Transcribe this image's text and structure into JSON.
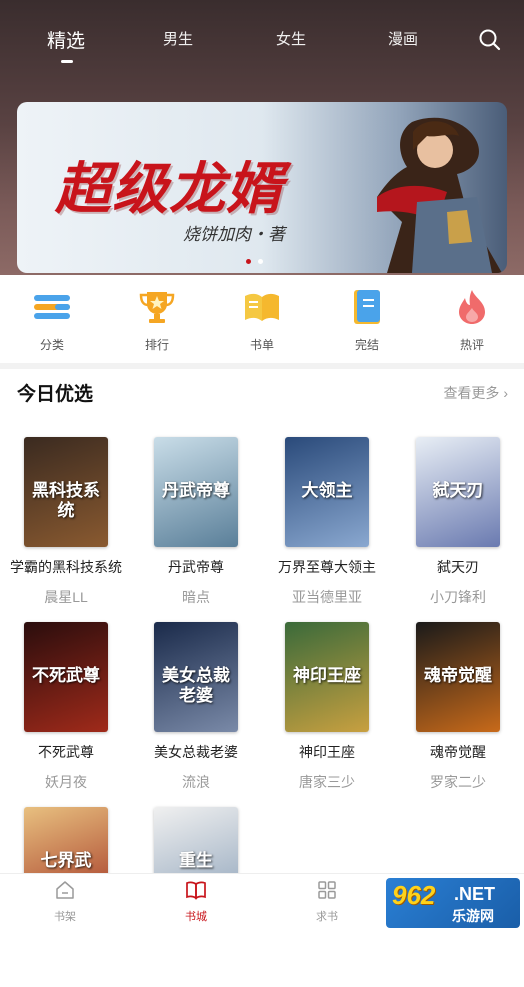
{
  "status_bar": {
    "time": "",
    "signal": ""
  },
  "top_tabs": [
    {
      "label": "精选",
      "active": true
    },
    {
      "label": "男生",
      "active": false
    },
    {
      "label": "女生",
      "active": false
    },
    {
      "label": "漫画",
      "active": false
    }
  ],
  "banner": {
    "title": "超级龙婿",
    "author": "烧饼加肉・著",
    "page_count": 2,
    "current_page": 1
  },
  "categories": [
    {
      "label": "分类",
      "icon": "list-icon",
      "color": "#4aa3ea"
    },
    {
      "label": "排行",
      "icon": "trophy-icon",
      "color": "#f5a623"
    },
    {
      "label": "书单",
      "icon": "open-book-icon",
      "color": "#f5c842"
    },
    {
      "label": "完结",
      "icon": "bookmark-book-icon",
      "color": "#f5b82e"
    },
    {
      "label": "热评",
      "icon": "flame-icon",
      "color": "#f06b6b"
    }
  ],
  "section": {
    "title": "今日优选",
    "more": "查看更多"
  },
  "books": [
    {
      "title": "学霸的黑科技系统",
      "author": "晨星LL",
      "cover_text": "黑科技系统",
      "cover_colors": [
        "#3a2a20",
        "#8a5a30"
      ]
    },
    {
      "title": "丹武帝尊",
      "author": "暗点",
      "cover_text": "丹武帝尊",
      "cover_colors": [
        "#c9dde8",
        "#5a7f99"
      ]
    },
    {
      "title": "万界至尊大领主",
      "author": "亚当德里亚",
      "cover_text": "大领主",
      "cover_colors": [
        "#2a4a7a",
        "#8aa8d0"
      ]
    },
    {
      "title": "弑天刃",
      "author": "小刀锋利",
      "cover_text": "弑天刃",
      "cover_colors": [
        "#e8eef5",
        "#6a7ab0"
      ]
    },
    {
      "title": "不死武尊",
      "author": "妖月夜",
      "cover_text": "不死武尊",
      "cover_colors": [
        "#2a0d0d",
        "#a02a1a"
      ]
    },
    {
      "title": "美女总裁老婆",
      "author": "流浪",
      "cover_text": "美女总裁老婆",
      "cover_colors": [
        "#1a2a4a",
        "#7a8aa8"
      ]
    },
    {
      "title": "神印王座",
      "author": "唐家三少",
      "cover_text": "神印王座",
      "cover_colors": [
        "#3a6a3a",
        "#c8a040"
      ]
    },
    {
      "title": "魂帝觉醒",
      "author": "罗家二少",
      "cover_text": "魂帝觉醒",
      "cover_colors": [
        "#1a1a1a",
        "#c86a1a"
      ]
    },
    {
      "title": "",
      "author": "",
      "cover_text": "七界武",
      "cover_colors": [
        "#e8c080",
        "#a03020"
      ]
    },
    {
      "title": "",
      "author": "",
      "cover_text": "重生",
      "cover_colors": [
        "#f0f0f0",
        "#8aa0b8"
      ]
    }
  ],
  "bottom_nav": [
    {
      "label": "书架",
      "icon": "home-icon",
      "active": false
    },
    {
      "label": "书城",
      "icon": "book-icon",
      "active": true
    },
    {
      "label": "求书",
      "icon": "grid-icon",
      "active": false
    }
  ],
  "watermark": {
    "num": "962",
    "net": ".NET",
    "sub": "乐游网"
  }
}
